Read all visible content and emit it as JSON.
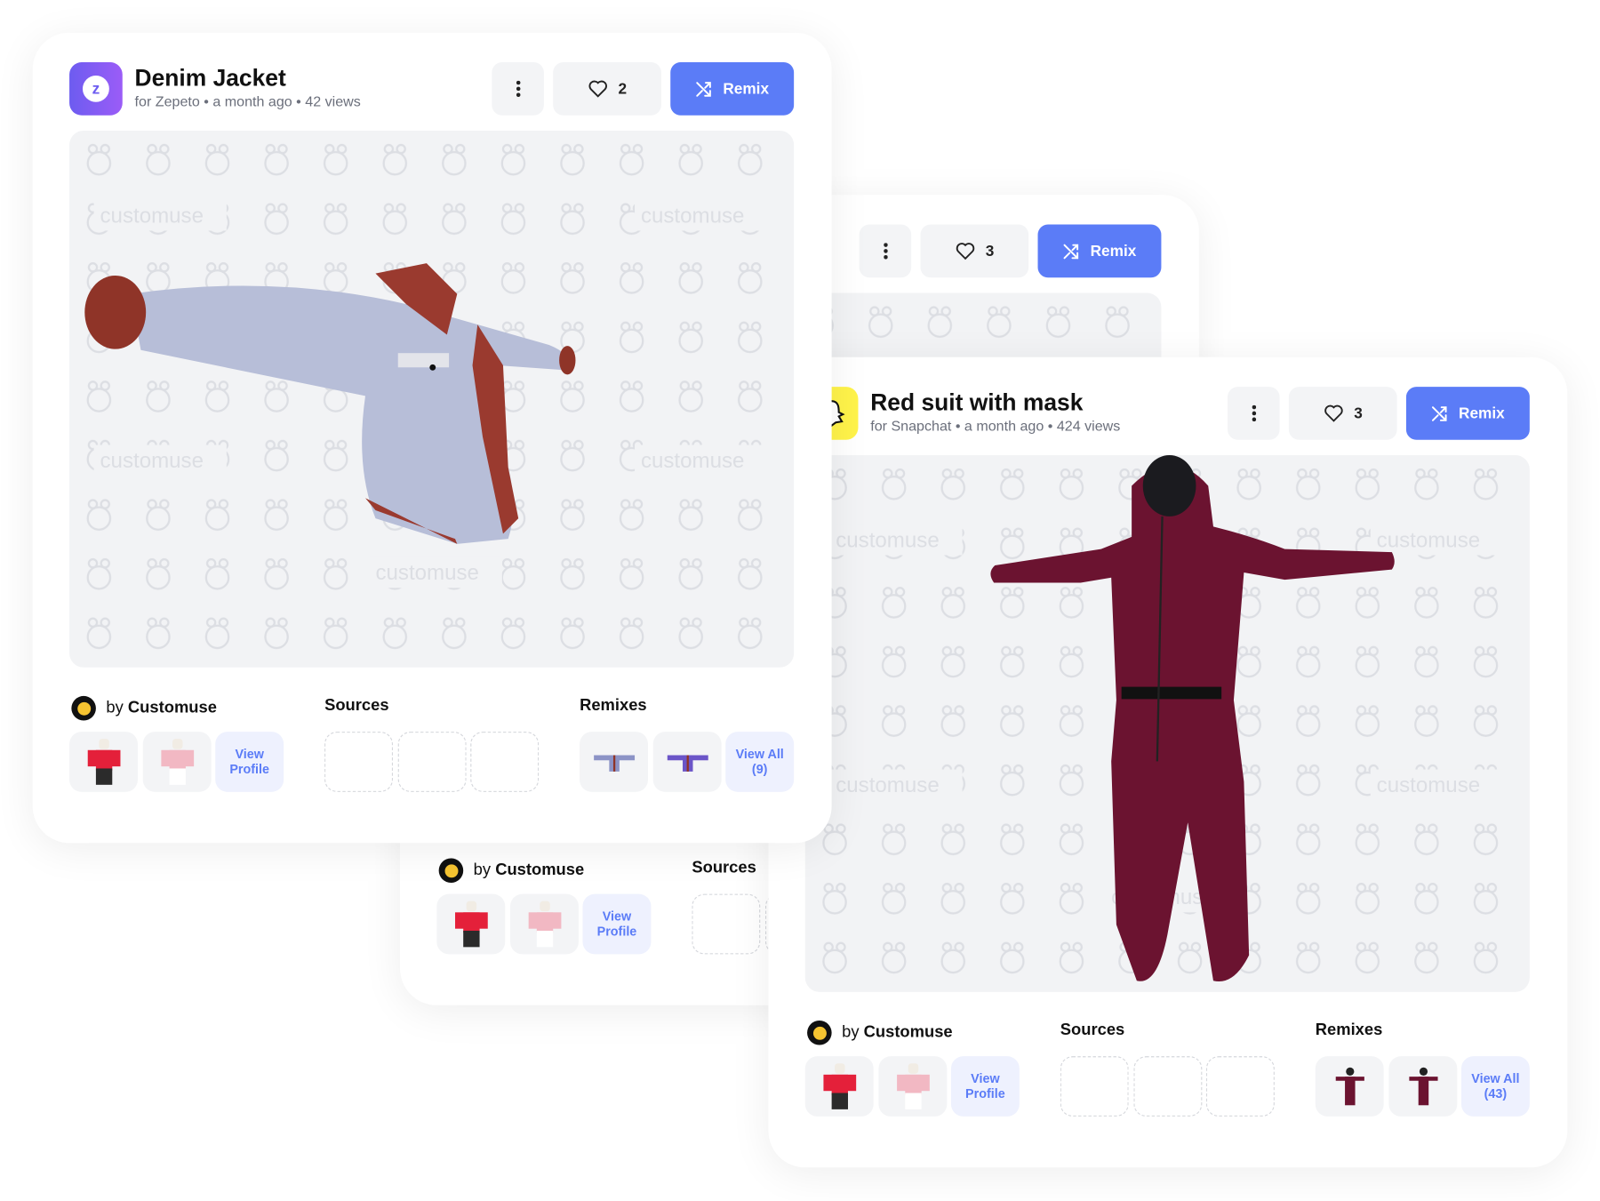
{
  "watermark": "customuse",
  "colors": {
    "accent": "#5b7cf7",
    "zepeto": "#7b5cf5",
    "snapchat": "#fffc00",
    "preview_bg": "#f2f3f5"
  },
  "cards": [
    {
      "id": "back",
      "title": "",
      "meta": "",
      "platform_icon": "",
      "likes": "3",
      "remix_label": "Remix",
      "creator": {
        "prefix": "by",
        "name": "Customuse"
      },
      "creator_items": [
        "red-outfit-thumbnail",
        "pink-outfit-thumbnail"
      ],
      "view_profile": [
        "View",
        "Profile"
      ],
      "sources_label": "Sources",
      "sources": 3,
      "remixes_label": "",
      "remixes": [],
      "view_all": [
        "",
        ""
      ],
      "model": "none"
    },
    {
      "id": "red-suit",
      "title": "Red suit with mask",
      "meta": "for Snapchat • a month ago • 424 views",
      "platform_icon": "snapchat-icon",
      "likes": "3",
      "remix_label": "Remix",
      "creator": {
        "prefix": "by",
        "name": "Customuse"
      },
      "creator_items": [
        "red-outfit-thumbnail",
        "pink-outfit-thumbnail"
      ],
      "view_profile": [
        "View",
        "Profile"
      ],
      "sources_label": "Sources",
      "sources": 3,
      "remixes_label": "Remixes",
      "remixes": [
        "red-suit-remix-thumbnail",
        "red-suit-remix-thumbnail"
      ],
      "view_all": [
        "View All",
        "(43)"
      ],
      "model": "suit"
    },
    {
      "id": "denim-jacket",
      "title": "Denim Jacket",
      "meta": "for Zepeto • a month ago • 42 views",
      "platform_icon": "zepeto-icon",
      "likes": "2",
      "remix_label": "Remix",
      "creator": {
        "prefix": "by",
        "name": "Customuse"
      },
      "creator_items": [
        "red-outfit-thumbnail",
        "pink-outfit-thumbnail"
      ],
      "view_profile": [
        "View",
        "Profile"
      ],
      "sources_label": "Sources",
      "sources": 3,
      "remixes_label": "Remixes",
      "remixes": [
        "jacket-remix-thumbnail",
        "jacket-remix-thumbnail"
      ],
      "view_all": [
        "View All",
        "(9)"
      ],
      "model": "jacket"
    }
  ]
}
